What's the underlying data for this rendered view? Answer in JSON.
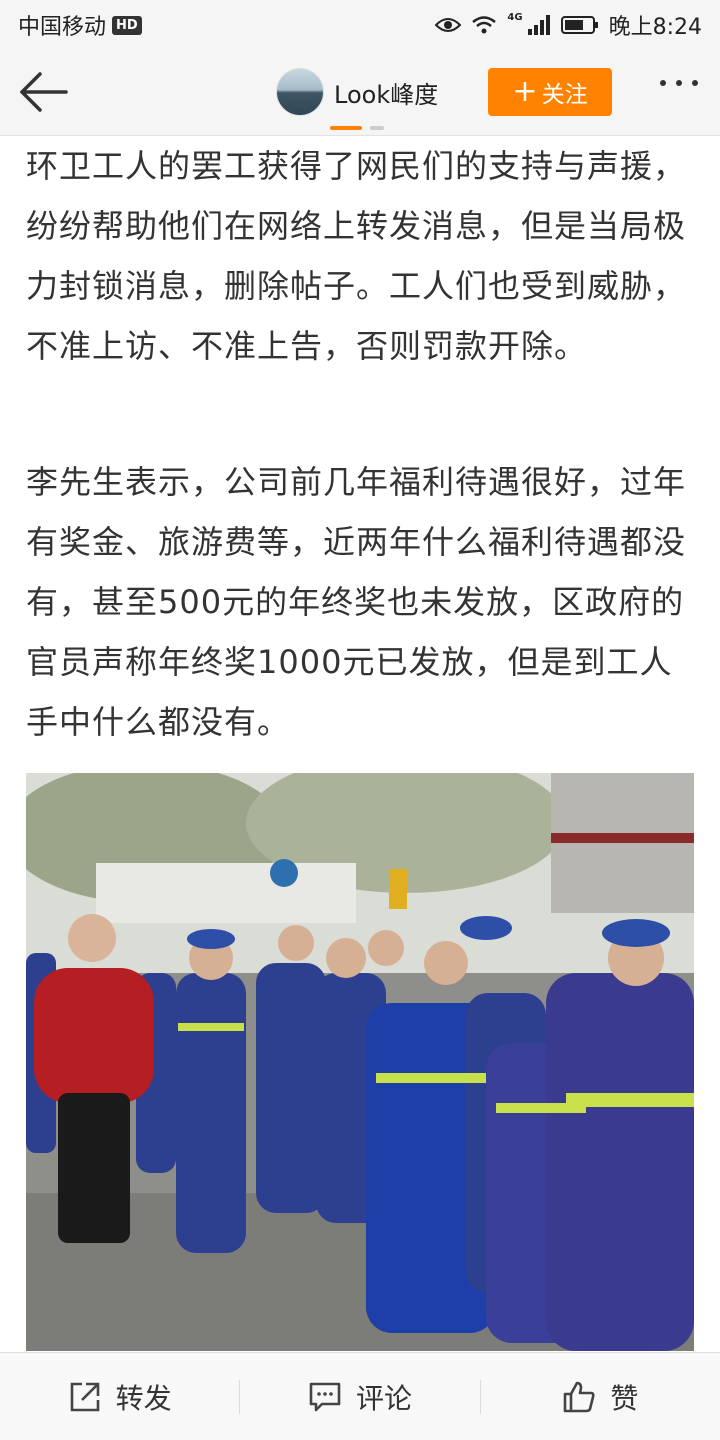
{
  "status_bar": {
    "carrier": "中国移动",
    "hd_badge": "HD",
    "network": "4G",
    "time": "晚上8:24"
  },
  "nav": {
    "account_name": "Look峰度",
    "follow_label": "关注",
    "follow_symbol": "+",
    "accent_color": "#ff8200"
  },
  "article": {
    "paragraphs": [
      "环卫工人的罢工获得了网民们的支持与声援，纷纷帮助他们在网络上转发消息，但是当局极力封锁消息，删除帖子。工人们也受到威胁，不准上访、不准上告，否则罚款开除。",
      "李先生表示，公司前几年福利待遇很好，过年有奖金、旅游费等，近两年什么福利待遇都没有，甚至500元的年终奖也未发放，区政府的官员声称年终奖1000元已发放，但是到工人手中什么都没有。"
    ]
  },
  "bottom_bar": {
    "repost_label": "转发",
    "comment_label": "评论",
    "like_label": "赞"
  },
  "icons": {
    "back": "back-arrow-icon",
    "more": "more-dots-icon",
    "repost": "repost-icon",
    "comment": "comment-icon",
    "like": "thumbs-up-icon"
  }
}
